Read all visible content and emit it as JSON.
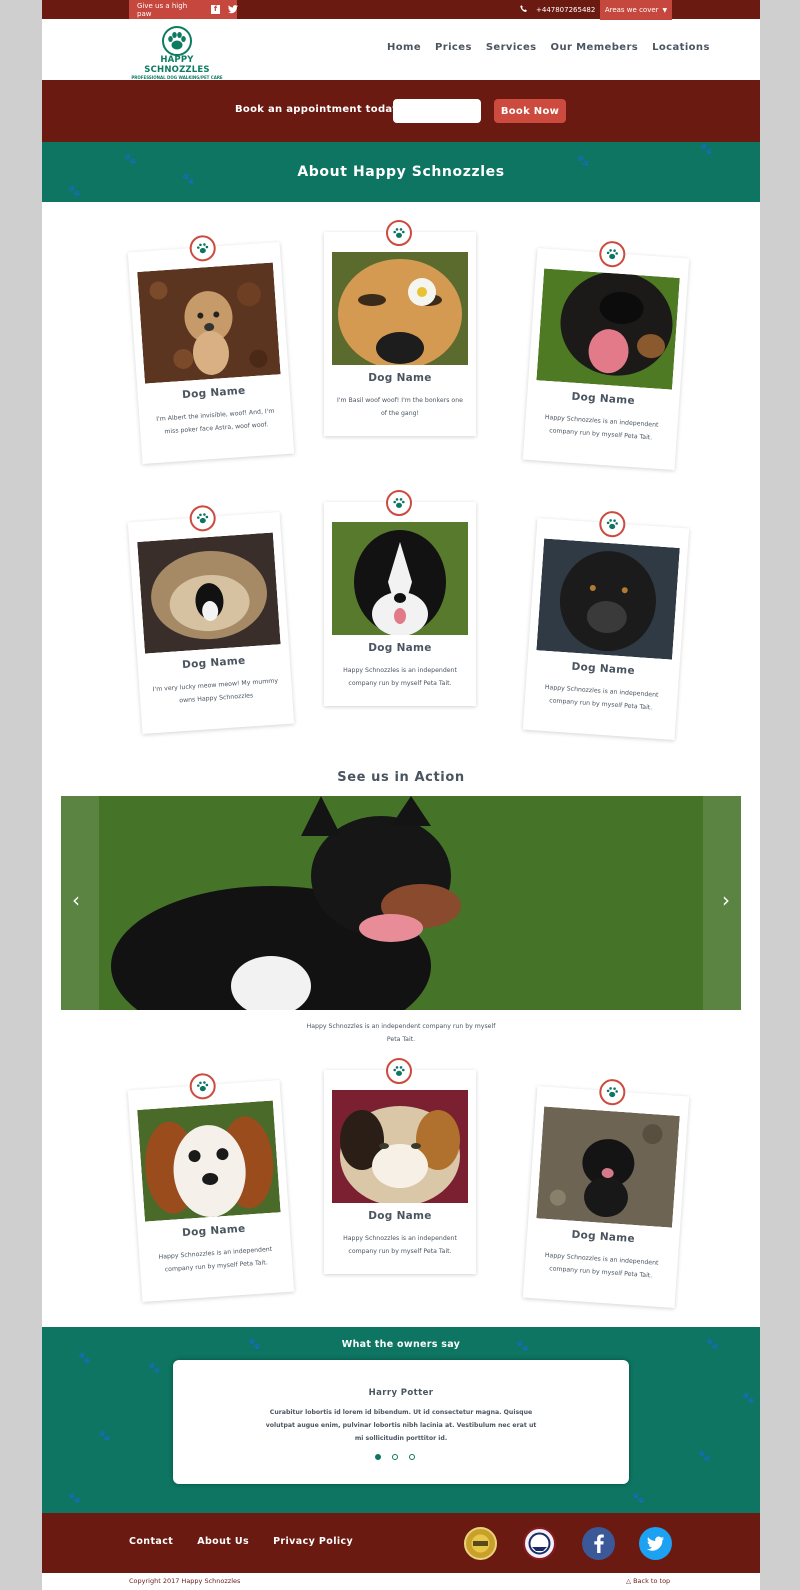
{
  "topbar": {
    "paw_label": "Give us a high paw",
    "facebook_letter": "f",
    "twitter_symbol": "t",
    "phone": "+447807265482",
    "areas_label": "Areas we cover"
  },
  "logo": {
    "name": "HAPPY SCHNOZZLES",
    "tagline": "PROFESSIONAL DOG WALKING/PET CARE"
  },
  "nav": [
    "Home",
    "Prices",
    "Services",
    "Our Memebers",
    "Locations"
  ],
  "booking": {
    "label": "Book an appointment today!",
    "button": "Book Now"
  },
  "about": {
    "title": "About Happy Schnozzles"
  },
  "cards": [
    {
      "name": "Dog Name",
      "desc": "I'm Albert the invisible, woof! And, I'm miss poker face Astra, woof woof."
    },
    {
      "name": "Dog Name",
      "desc": "I'm Basil woof woof! I'm the bonkers one of the gang!"
    },
    {
      "name": "Dog Name",
      "desc": "Happy Schnozzles is an independent company run by myself Peta Tait."
    },
    {
      "name": "Dog Name",
      "desc": "I'm very lucky meow meow! My mummy owns Happy Schnozzles"
    },
    {
      "name": "Dog Name",
      "desc": "Happy Schnozzles is an independent company run by myself Peta Tait."
    },
    {
      "name": "Dog Name",
      "desc": "Happy Schnozzles is an independent company run by myself Peta Tait."
    },
    {
      "name": "Dog Name",
      "desc": "Happy Schnozzles is an independent company run by myself Peta Tait."
    },
    {
      "name": "Dog Name",
      "desc": "Happy Schnozzles is an independent company run by myself Peta Tait."
    },
    {
      "name": "Dog Name",
      "desc": "Happy Schnozzles is an independent company run by myself Peta Tait."
    }
  ],
  "action": {
    "title": "See us in Action",
    "caption": "Happy Schnozzles is an independent company run by myself Peta Tait.",
    "prev": "‹",
    "next": "›"
  },
  "owners": {
    "title": "What the owners say",
    "author": "Harry Potter",
    "quote": "Curabitur lobortis id lorem id bibendum. Ut id consectetur magna. Quisque volutpat augue enim, pulvinar lobortis nibh lacinia at. Vestibulum nec erat ut mi sollicitudin porttitor id."
  },
  "footer": {
    "links": [
      "Contact",
      "About Us",
      "Privacy Policy"
    ],
    "copyright": "Copyright 2017 Happy Schnozzles",
    "back_to_top": "Back to top"
  },
  "colors": {
    "brand_red": "#6b1a12",
    "accent_red": "#cc4a3e",
    "teal": "#0d7561",
    "text": "#4a5560"
  }
}
